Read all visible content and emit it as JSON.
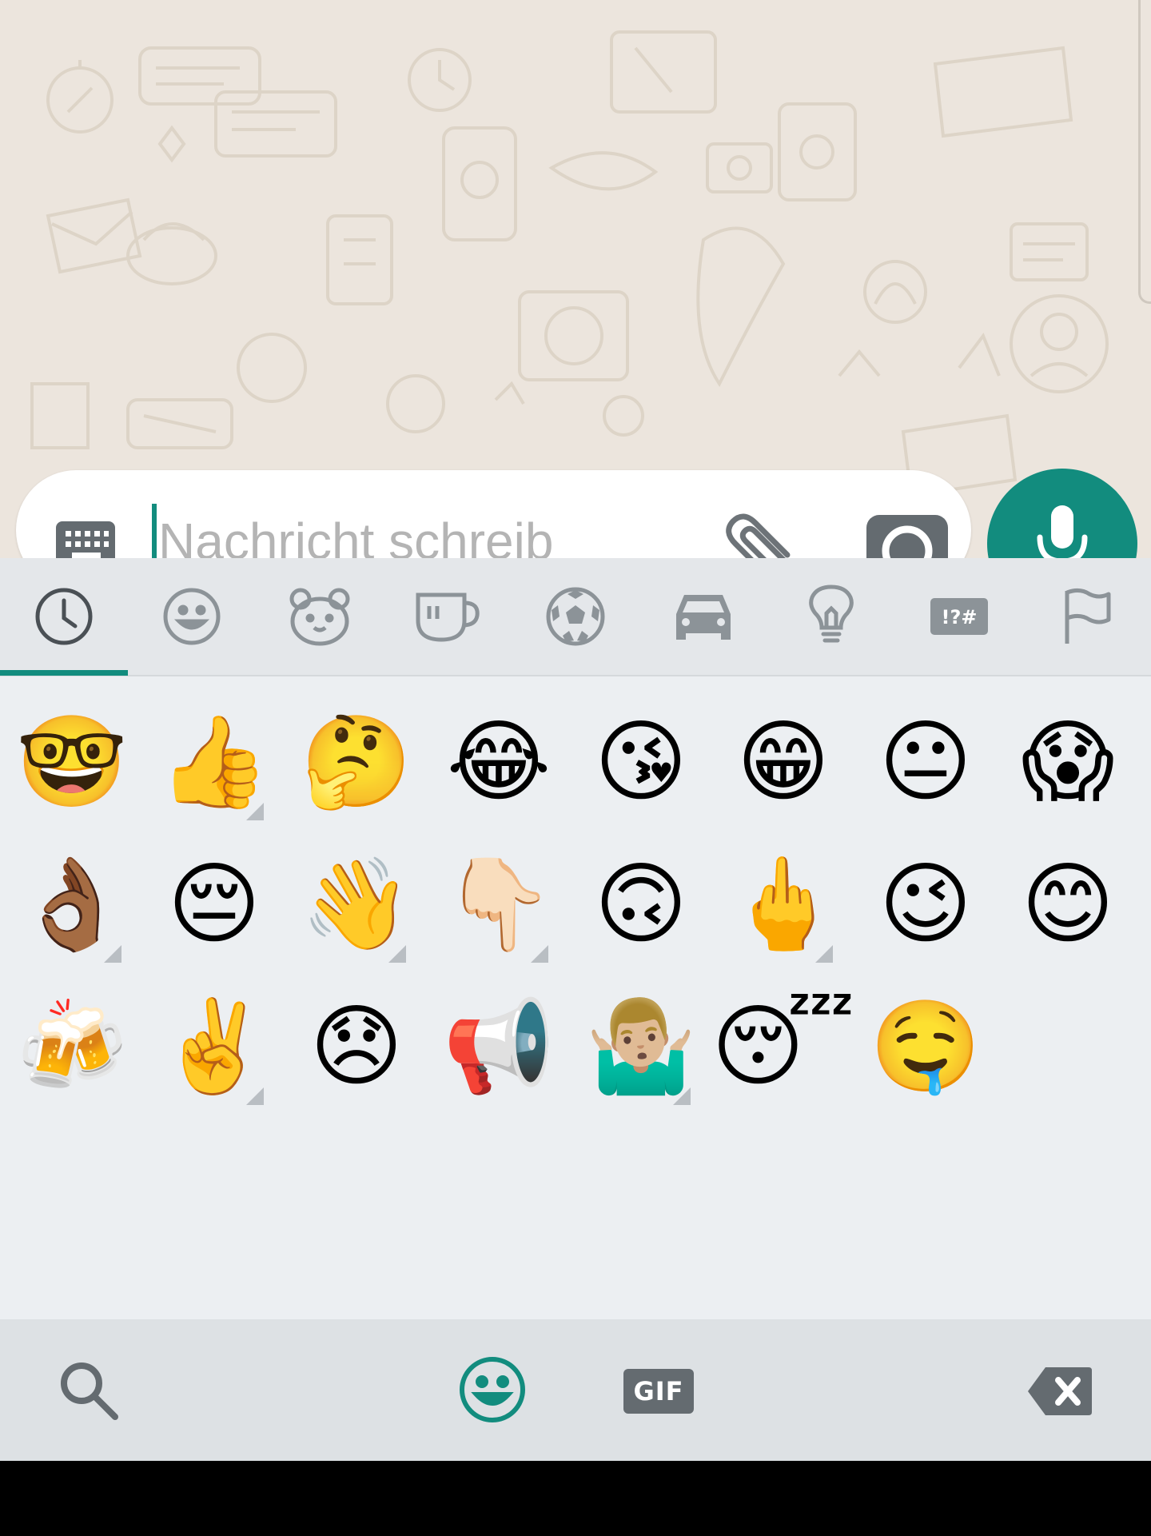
{
  "composer": {
    "placeholder": "Nachricht schreib",
    "keyboard_toggle_icon": "keyboard-icon",
    "attach_icon": "paperclip-icon",
    "camera_icon": "camera-icon",
    "mic_icon": "microphone-icon"
  },
  "category_tabs": [
    {
      "name": "recent",
      "icon": "clock-icon",
      "selected": true
    },
    {
      "name": "smileys",
      "icon": "smiley-icon",
      "selected": false
    },
    {
      "name": "animals",
      "icon": "bear-icon",
      "selected": false
    },
    {
      "name": "food",
      "icon": "cup-icon",
      "selected": false
    },
    {
      "name": "activities",
      "icon": "soccer-ball-icon",
      "selected": false
    },
    {
      "name": "travel",
      "icon": "car-icon",
      "selected": false
    },
    {
      "name": "objects",
      "icon": "lightbulb-icon",
      "selected": false
    },
    {
      "name": "symbols",
      "icon": "symbols-icon",
      "label": "!?#",
      "selected": false
    },
    {
      "name": "flags",
      "icon": "flag-icon",
      "selected": false
    }
  ],
  "recent_emojis": [
    {
      "char": "🤓",
      "tone": false
    },
    {
      "char": "👍",
      "tone": true
    },
    {
      "char": "🤔",
      "tone": false
    },
    {
      "char": "😂",
      "tone": false
    },
    {
      "char": "😘",
      "tone": false
    },
    {
      "char": "😁",
      "tone": false
    },
    {
      "char": "😐",
      "tone": false
    },
    {
      "char": "😱",
      "tone": false
    },
    {
      "char": "👌🏾",
      "tone": true
    },
    {
      "char": "😔",
      "tone": false
    },
    {
      "char": "👋",
      "tone": true
    },
    {
      "char": "👇🏻",
      "tone": true
    },
    {
      "char": "🙃",
      "tone": false
    },
    {
      "char": "🖕",
      "tone": true
    },
    {
      "char": "😉",
      "tone": false
    },
    {
      "char": "😊",
      "tone": false
    },
    {
      "char": "🍻",
      "tone": false
    },
    {
      "char": "✌️",
      "tone": true
    },
    {
      "char": "😞",
      "tone": false
    },
    {
      "char": "📢",
      "tone": false
    },
    {
      "char": "🤷🏼‍♂️",
      "tone": true
    },
    {
      "char": "😴",
      "tone": false
    },
    {
      "char": "🤤",
      "tone": false
    }
  ],
  "bottom_bar": {
    "search_icon": "search-icon",
    "emoji_mode_icon": "smiley-icon",
    "gif_label": "GIF",
    "backspace_icon": "backspace-icon"
  },
  "colors": {
    "accent": "#128c7e",
    "wallpaper": "#ece5dd",
    "panel": "#eceff2",
    "icon_gray": "#6d7378"
  }
}
